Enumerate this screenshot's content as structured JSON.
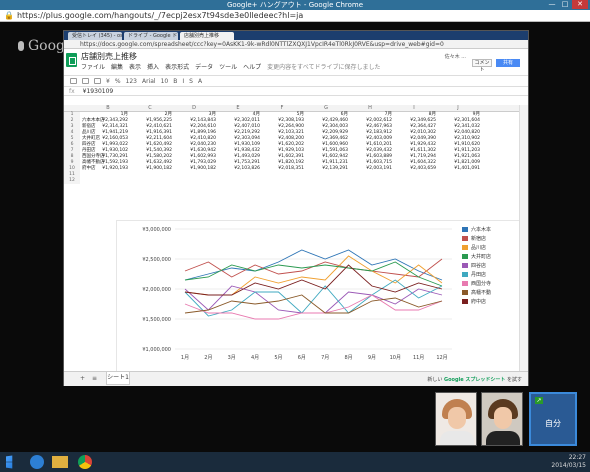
{
  "outer": {
    "title": "Google+ ハングアウト - Google Chrome",
    "url": "https://plus.google.com/hangouts/_/7ecpj2esx7t94sde3e0lledeec?hl=ja",
    "logo": "Google"
  },
  "inner": {
    "tabs": [
      "受信トレイ (345) - osho...",
      "ドライブ - Google ドラ...",
      "店舗別売上推移"
    ],
    "url": "https://docs.google.com/spreadsheet/ccc?key=0AsKK1-9k-wRdl0NTTlZXQXJ1VpcIR4eTl0RkJ0RVE&usp=drive_web#gid=0",
    "doc_title": "店舗別売上推移",
    "menu": [
      "ファイル",
      "編集",
      "表示",
      "挿入",
      "表示形式",
      "データ",
      "ツール",
      "ヘルプ"
    ],
    "save_status": "変更内容をすべてドライブに保存しました",
    "owner": "佐々木 ...",
    "comment_label": "コメント",
    "share_label": "共有",
    "toolbar": [
      "¥",
      "%",
      "123",
      "Arial",
      "10",
      "B",
      "I",
      "S",
      "A"
    ],
    "formula_ref": "fx",
    "formula_value": "¥1930109",
    "columns": [
      "",
      "B",
      "C",
      "D",
      "E",
      "F",
      "G",
      "H",
      "I",
      "J"
    ],
    "months_header": [
      "1月",
      "2月",
      "3月",
      "4月",
      "5月",
      "6月",
      "7月",
      "8月",
      "9月"
    ],
    "rows": [
      {
        "n": "1",
        "label": "",
        "vals": [
          "1月",
          "2月",
          "3月",
          "4月",
          "5月",
          "6月",
          "7月",
          "8月",
          "9月"
        ]
      },
      {
        "n": "2",
        "label": "六本木本店",
        "vals": [
          "¥2,343,292",
          "¥1,956,225",
          "¥2,143,843",
          "¥2,302,011",
          "¥2,308,193",
          "¥2,429,460",
          "¥2,002,612",
          "¥2,349,625",
          "¥2,301,604"
        ]
      },
      {
        "n": "3",
        "label": "新宿店",
        "vals": [
          "¥2,314,321",
          "¥2,410,621",
          "¥2,204,610",
          "¥2,407,010",
          "¥2,264,900",
          "¥2,304,003",
          "¥2,467,963",
          "¥2,364,427",
          "¥2,341,032"
        ]
      },
      {
        "n": "4",
        "label": "品川店",
        "vals": [
          "¥1,941,219",
          "¥1,916,391",
          "¥1,899,196",
          "¥2,219,292",
          "¥2,103,321",
          "¥2,209,929",
          "¥2,183,912",
          "¥2,010,302",
          "¥2,040,820"
        ]
      },
      {
        "n": "5",
        "label": "大井町店",
        "vals": [
          "¥2,160,053",
          "¥2,211,604",
          "¥2,410,820",
          "¥2,303,094",
          "¥2,408,200",
          "¥2,369,462",
          "¥2,403,009",
          "¥2,049,390",
          "¥2,310,902"
        ]
      },
      {
        "n": "6",
        "label": "四谷店",
        "vals": [
          "¥1,993,022",
          "¥1,620,492",
          "¥2,040,230",
          "¥1,930,109",
          "¥1,620,202",
          "¥1,600,960",
          "¥1,610,201",
          "¥1,929,432",
          "¥1,910,620"
        ]
      },
      {
        "n": "7",
        "label": "丹田店",
        "vals": [
          "¥1,930,102",
          "¥1,540,392",
          "¥1,630,942",
          "¥1,938,432",
          "¥1,929,103",
          "¥1,591,063",
          "¥2,039,432",
          "¥1,611,302",
          "¥1,911,203"
        ]
      },
      {
        "n": "8",
        "label": "西国分寺店",
        "vals": [
          "¥1,730,291",
          "¥1,580,202",
          "¥1,602,993",
          "¥1,493,029",
          "¥1,602,391",
          "¥1,602,942",
          "¥1,603,889",
          "¥1,719,294",
          "¥1,921,063"
        ]
      },
      {
        "n": "9",
        "label": "高幡不動店",
        "vals": [
          "¥1,592,193",
          "¥1,632,492",
          "¥1,793,029",
          "¥1,753,291",
          "¥1,820,192",
          "¥1,911,231",
          "¥1,603,715",
          "¥1,604,322",
          "¥1,821,009"
        ]
      },
      {
        "n": "10",
        "label": "府中店",
        "vals": [
          "¥1,920,193",
          "¥1,900,182",
          "¥1,900,182",
          "¥2,103,826",
          "¥2,018,351",
          "¥2,139,291",
          "¥2,003,191",
          "¥2,403,659",
          "¥1,401,091"
        ]
      },
      {
        "n": "11",
        "label": "",
        "vals": []
      },
      {
        "n": "12",
        "label": "",
        "vals": []
      }
    ],
    "sheet_tab": "シート1",
    "add_sheet": "+",
    "list_sheets": "≡",
    "bottom_note_prefix": "新しい",
    "bottom_note_brand": "Google スプレッドシート",
    "bottom_note_suffix": "を試す"
  },
  "chart_data": {
    "type": "line",
    "categories": [
      "1月",
      "2月",
      "3月",
      "4月",
      "5月",
      "6月",
      "7月",
      "8月",
      "9月",
      "10月",
      "11月",
      "12月"
    ],
    "ylim": [
      1000000,
      3000000
    ],
    "yticks": [
      "¥1,000,000",
      "¥1,500,000",
      "¥2,000,000",
      "¥2,500,000",
      "¥3,000,000"
    ],
    "series": [
      {
        "name": "六本木本",
        "color": "#2e75b6",
        "values": [
          2150000,
          2250000,
          2350000,
          2300000,
          2450000,
          2650000,
          2500000,
          2650000,
          2400000,
          2500000,
          2300000,
          2150000
        ]
      },
      {
        "name": "新宿店",
        "color": "#c0504d",
        "values": [
          2300000,
          2450000,
          2200000,
          2400000,
          2250000,
          2300000,
          2450000,
          2350000,
          2300000,
          2250000,
          2200000,
          2500000
        ]
      },
      {
        "name": "品川店",
        "color": "#f0a030",
        "values": [
          1950000,
          1900000,
          1900000,
          2200000,
          2100000,
          2200000,
          2150000,
          2550000,
          2300000,
          2100000,
          2400000,
          2100000
        ]
      },
      {
        "name": "大井町店",
        "color": "#2a9a50",
        "values": [
          2150000,
          2200000,
          2400000,
          2300000,
          2400000,
          2350000,
          2400000,
          2350000,
          2300000,
          2450000,
          2200000,
          2050000
        ]
      },
      {
        "name": "四谷店",
        "color": "#9b59b6",
        "values": [
          2000000,
          1650000,
          2050000,
          1950000,
          1650000,
          1600000,
          1600000,
          1950000,
          1900000,
          1750000,
          2000000,
          1900000
        ]
      },
      {
        "name": "丹田店",
        "color": "#3fa9c0",
        "values": [
          1950000,
          1550000,
          1650000,
          1950000,
          1950000,
          1600000,
          2050000,
          1600000,
          1900000,
          2150000,
          1850000,
          2050000
        ]
      },
      {
        "name": "西国分寺",
        "color": "#e87ab0",
        "values": [
          1750000,
          1600000,
          1600000,
          1500000,
          1500000,
          1600000,
          1600000,
          1700000,
          1900000,
          1650000,
          1650000,
          1800000
        ]
      },
      {
        "name": "高幡不動",
        "color": "#8a5a2a",
        "values": [
          1600000,
          1650000,
          1800000,
          1750000,
          1800000,
          1900000,
          1600000,
          1600000,
          1800000,
          1850000,
          1700000,
          1800000
        ]
      },
      {
        "name": "府中店",
        "color": "#7a1f1f",
        "values": [
          1950000,
          1900000,
          1900000,
          2100000,
          2000000,
          2150000,
          2000000,
          2400000,
          2050000,
          1950000,
          2100000,
          2000000
        ]
      }
    ]
  },
  "participants": {
    "self_label": "自分"
  },
  "taskbar": {
    "time": "22:27",
    "date": "2014/03/15"
  }
}
